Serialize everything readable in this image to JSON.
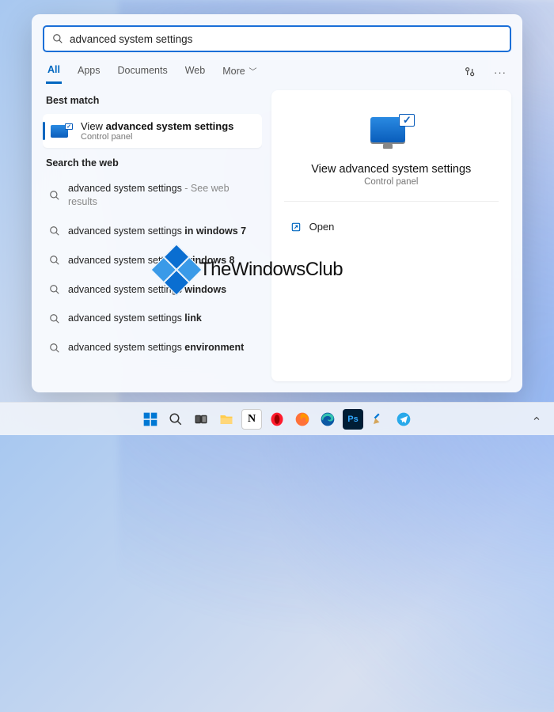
{
  "search": {
    "value": "advanced system settings"
  },
  "tabs": {
    "items": [
      "All",
      "Apps",
      "Documents",
      "Web",
      "More"
    ],
    "active_index": 0
  },
  "best_match": {
    "heading": "Best match",
    "title_prefix": "View ",
    "title_highlight": "advanced system settings",
    "subtitle": "Control panel"
  },
  "web": {
    "heading": "Search the web",
    "items": [
      {
        "plain": "advanced system settings",
        "suffix_muted": " - See web results",
        "bold": ""
      },
      {
        "plain": "advanced system settings ",
        "suffix_muted": "",
        "bold": "in windows 7"
      },
      {
        "plain": "advanced system settings ",
        "suffix_muted": "",
        "bold": "windows 8"
      },
      {
        "plain": "advanced system settings ",
        "suffix_muted": "",
        "bold": "windows"
      },
      {
        "plain": "advanced system settings ",
        "suffix_muted": "",
        "bold": "link"
      },
      {
        "plain": "advanced system settings ",
        "suffix_muted": "",
        "bold": "environment"
      }
    ]
  },
  "preview": {
    "title": "View advanced system settings",
    "subtitle": "Control panel",
    "action_open": "Open"
  },
  "watermark": {
    "text": "TheWindowsClub"
  },
  "taskbar": {
    "apps": [
      "start",
      "search",
      "task-view",
      "explorer",
      "notion",
      "opera",
      "firefox",
      "edge",
      "photoshop",
      "paint",
      "telegram"
    ]
  }
}
